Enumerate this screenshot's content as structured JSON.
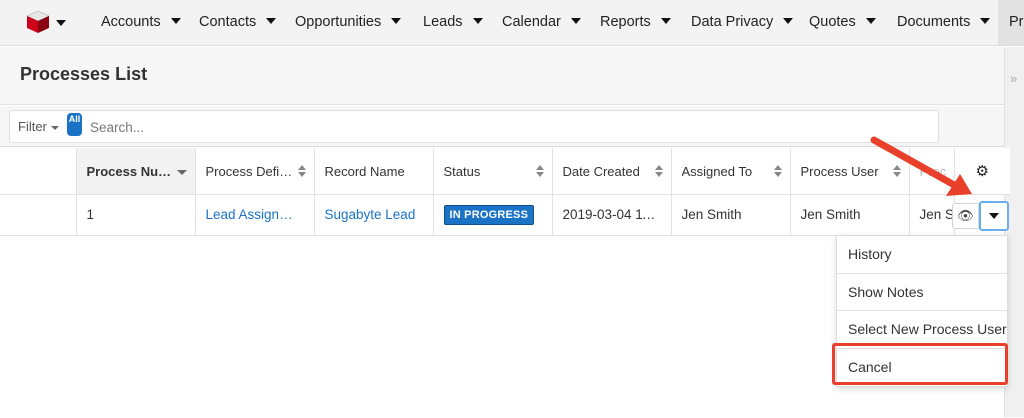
{
  "nav": {
    "items": [
      "Accounts",
      "Contacts",
      "Opportunities",
      "Leads",
      "Calendar",
      "Reports",
      "Data Privacy",
      "Quotes",
      "Documents"
    ],
    "partial_item": "Pr"
  },
  "page": {
    "title": "Processes List"
  },
  "filter": {
    "label": "Filter",
    "all_badge": "All",
    "search_placeholder": "Search..."
  },
  "table": {
    "columns": [
      "Process Num...",
      "Process Definit...",
      "Record Name",
      "Status",
      "Date Created",
      "Assigned To",
      "Process User",
      "Proc"
    ],
    "rows": [
      {
        "process_number": "1",
        "process_definition": "Lead Assignme...",
        "record_name": "Sugabyte Lead",
        "status": "IN PROGRESS",
        "date_created": "2019-03-04 11:...",
        "assigned_to": "Jen Smith",
        "process_user": "Jen Smith",
        "proc": "Jen S"
      }
    ]
  },
  "row_actions": {
    "menu": [
      "History",
      "Show Notes",
      "Select New Process User",
      "Cancel"
    ]
  },
  "colors": {
    "accent": "#1b73c6",
    "highlight": "#e8402a"
  }
}
